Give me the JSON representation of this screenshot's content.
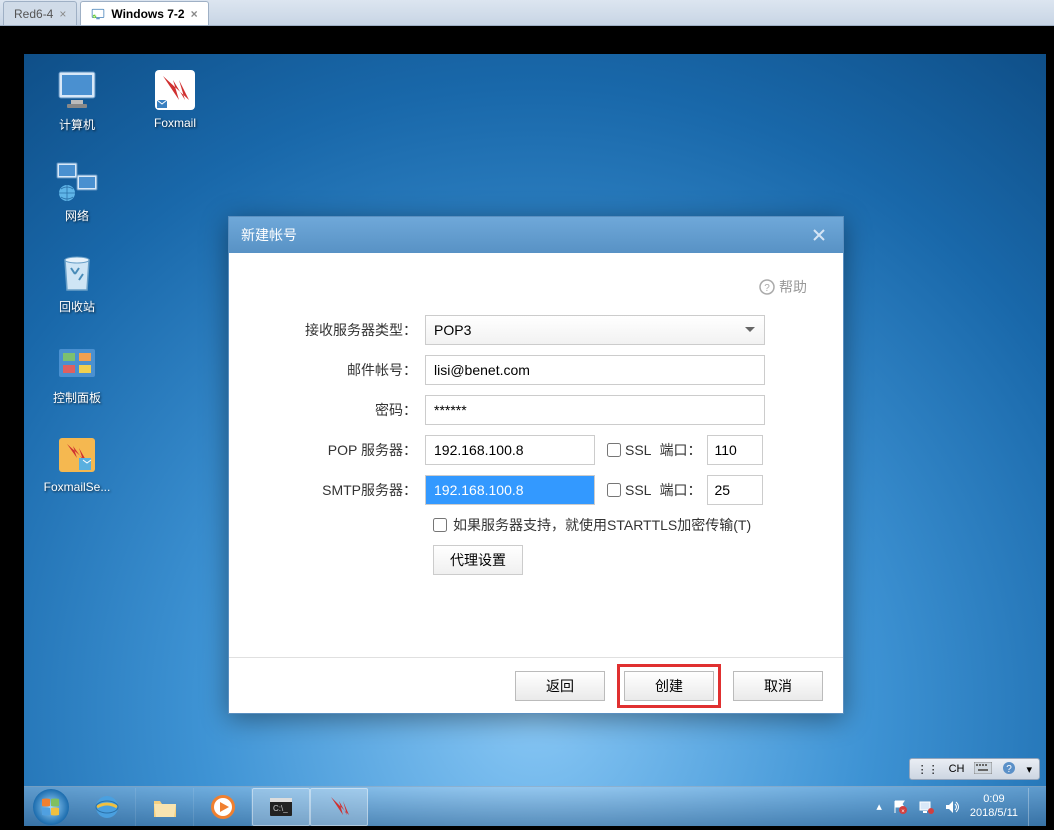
{
  "vmtabs": {
    "inactive": "Red6-4",
    "active": "Windows 7-2"
  },
  "desktop_icons": {
    "computer": "计算机",
    "foxmail": "Foxmail",
    "network": "网络",
    "recyclebin": "回收站",
    "controlpanel": "控制面板",
    "foxmailserver": "FoxmailSe..."
  },
  "dialog": {
    "title": "新建帐号",
    "help": "帮助",
    "labels": {
      "recv_type": "接收服务器类型：",
      "email": "邮件帐号：",
      "password": "密码：",
      "pop": "POP 服务器：",
      "smtp": "SMTP服务器：",
      "ssl": "SSL",
      "port": "端口：",
      "starttls": "如果服务器支持，就使用STARTTLS加密传输(T)",
      "proxy": "代理设置"
    },
    "values": {
      "recv_type": "POP3",
      "email": "lisi@benet.com",
      "password": "******",
      "pop_server": "192.168.100.8",
      "pop_port": "110",
      "smtp_server": "192.168.100.8",
      "smtp_port": "25"
    },
    "buttons": {
      "back": "返回",
      "create": "创建",
      "cancel": "取消"
    }
  },
  "langbar": {
    "ch": "CH"
  },
  "tray": {
    "time": "0:09",
    "date": "2018/5/11"
  }
}
